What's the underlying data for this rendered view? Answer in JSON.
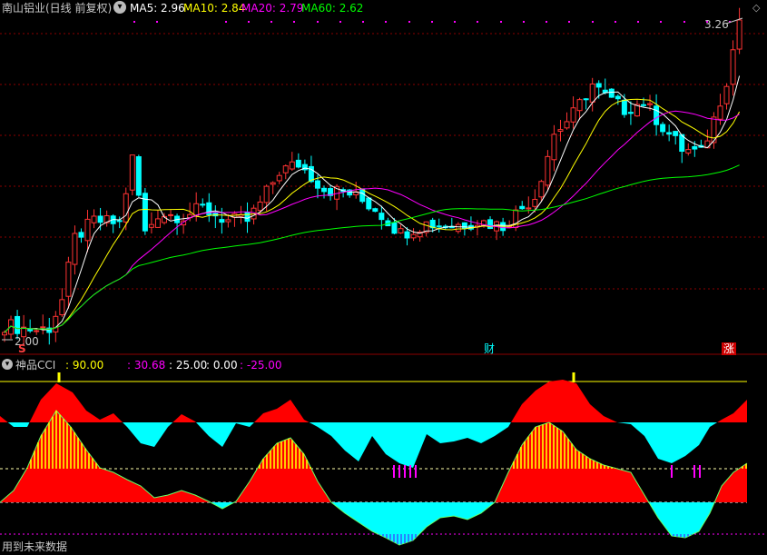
{
  "header": {
    "stock_title": "南山铝业(日线 前复权)",
    "ma5_label": "MA5: 2.96",
    "ma10_label": "MA10: 2.84",
    "ma20_label": "MA20: 2.79",
    "ma60_label": "MA60: 2.62",
    "settings_icon": "chevron-down-circle-icon",
    "top_right_icon": "diamond-icon"
  },
  "price_panel": {
    "high_marker": "3.26",
    "low_marker": "2.00",
    "event_markers": [
      "S",
      "财",
      "涨"
    ]
  },
  "indicator_header": {
    "name": "神品CCI",
    "value1": ": 90.00",
    "value2": ": 30.68",
    "value3": ": 25.00",
    "value4": ": 0.00",
    "value5": ": -25.00"
  },
  "footer_text": "用到未来数据",
  "colors": {
    "up": "#ff3333",
    "down": "#00ffff",
    "ma5": "#ffffff",
    "ma10": "#ffff00",
    "ma20": "#ff00ff",
    "ma60": "#00ff00",
    "grid": "#8b0000"
  },
  "chart_data": [
    {
      "type": "candlestick",
      "title": "南山铝业(日线 前复权)",
      "price_high": 3.26,
      "price_low": 2.0,
      "series": [
        {
          "name": "MA5",
          "last": 2.96
        },
        {
          "name": "MA10",
          "last": 2.84
        },
        {
          "name": "MA20",
          "last": 2.79
        },
        {
          "name": "MA60",
          "last": 2.62
        }
      ]
    },
    {
      "type": "area",
      "title": "神品CCI",
      "reference_lines": [
        90.0,
        25.0,
        0.0,
        -25.0
      ],
      "current_value": 30.68
    }
  ]
}
